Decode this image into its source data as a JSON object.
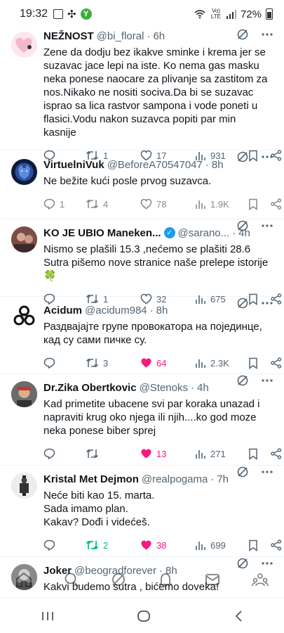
{
  "status": {
    "time": "19:32",
    "lte": "Vo) LTE",
    "battery": "72%"
  },
  "tweets": [
    {
      "name": "NEŽNOST",
      "handle": "@bi_floral",
      "ago": "6h",
      "text": "Zene da dodju bez ikakve sminke i krema jer se suzavac jace lepi na iste. Ko nema gas masku neka ponese naocare za plivanje sa zastitom za nos.Nikako ne nositi sociva.Da bi se suzavac isprao sa lica rastvor sampona i vode poneti u flasici.Vodu nakon suzavca popiti par min kasnije",
      "retweets": "1",
      "likes": "17",
      "views": "931",
      "reply_count": "",
      "liked": false,
      "rt_on": false
    },
    {
      "name": "VirtuelniVuk",
      "handle": "@BeforeA70547047",
      "ago": "8h",
      "text": "Ne bežite kući posle prvog suzavca.",
      "reply_count": "1",
      "retweets": "4",
      "likes": "78",
      "views": "1.9K",
      "liked": false,
      "rt_on": false
    },
    {
      "name": "KO JE UBIO Maneken...",
      "handle": "@sarano...",
      "ago": "4h",
      "text": "Nismo se plašili 15.3 ,nećemo se plašiti 28.6\nSutra pišemo nove stranice naše prelepe istorije 🍀",
      "reply_count": "",
      "retweets": "1",
      "likes": "32",
      "views": "675",
      "liked": false,
      "rt_on": false
    },
    {
      "name": "Acidum",
      "handle": "@acidum984",
      "ago": "8h",
      "text": "Раздвајајте групе провокатора на појединце, кад су сами пичке су.",
      "reply_count": "",
      "retweets": "3",
      "likes": "64",
      "views": "2.3K",
      "liked": true,
      "rt_on": false
    },
    {
      "name": "Dr.Zika Obertkovic",
      "handle": "@Stenoks",
      "ago": "4h",
      "text": "Kad primetite ubacene svi par koraka unazad i napraviti krug oko njega ili njih....ko god moze neka ponese biber  sprej",
      "reply_count": "",
      "retweets": "",
      "likes": "13",
      "views": "271",
      "liked": true,
      "rt_on": false
    },
    {
      "name": "Kristal Met Dejmon",
      "handle": "@realpogama",
      "ago": "7h",
      "text": "Neće biti kao 15. marta.\nSada imamo plan.\nKakav? Dođi i videćeš.",
      "reply_count": "",
      "retweets": "2",
      "likes": "38",
      "views": "699",
      "liked": true,
      "rt_on": true
    },
    {
      "name": "Joker",
      "handle": "@beogradforever",
      "ago": "8h",
      "text": "Kakvi budemo sutra , bićemo doveka!",
      "reply_count": "",
      "retweets": "",
      "likes": "",
      "views": "",
      "liked": false,
      "rt_on": false
    }
  ],
  "icons": {
    "reply": "reply-icon",
    "retweet": "retweet-icon",
    "like": "heart-icon",
    "views": "views-icon",
    "bookmark": "bookmark-icon",
    "share": "share-icon",
    "grok": "grok-icon",
    "more": "more-icon"
  },
  "colors": {
    "like_active": "#f91880",
    "retweet_active": "#00ba7c",
    "verified": "#1d9bf0",
    "muted": "#536471"
  }
}
